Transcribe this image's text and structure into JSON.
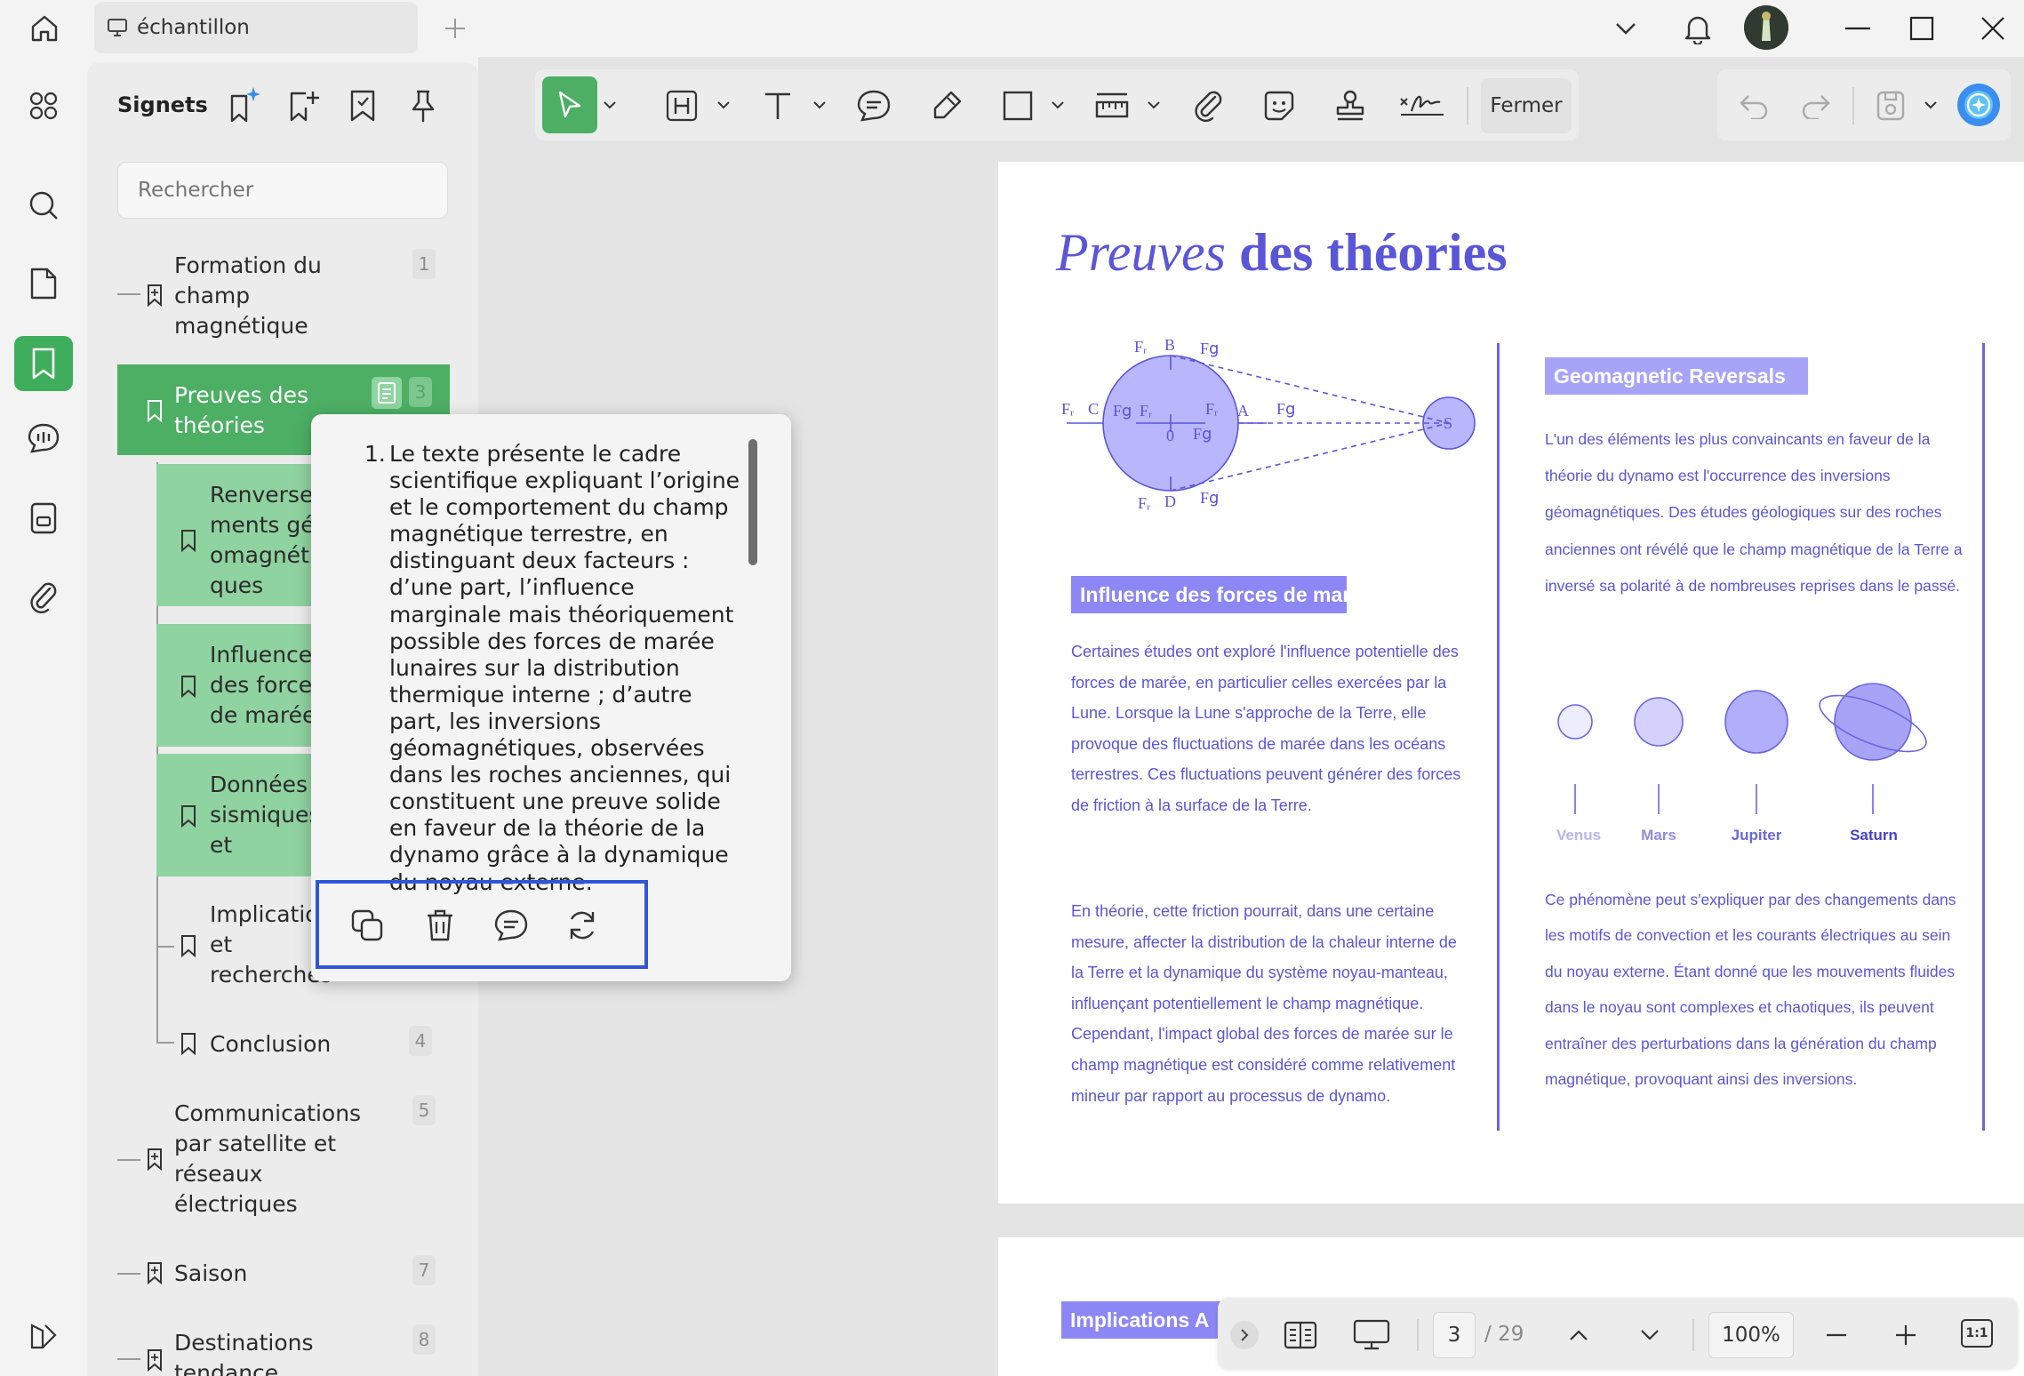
{
  "tab": {
    "title": "échantillon"
  },
  "sidebar": {
    "title": "Signets",
    "search_placeholder": "Rechercher"
  },
  "bookmarks": [
    {
      "label": "Formation du champ magnétique",
      "page": "1"
    },
    {
      "label": "Preuves des théories",
      "page": "3"
    },
    {
      "label": "Renversements géomagnétiques",
      "page": ""
    },
    {
      "label": "Influence des forces de marée",
      "page": ""
    },
    {
      "label": "Données sismiques et géodésiques",
      "page": ""
    },
    {
      "label": "Implications et recherches futures",
      "page": ""
    },
    {
      "label": "Conclusion",
      "page": "4"
    },
    {
      "label": "Communications par satellite et réseaux électriques",
      "page": "5"
    },
    {
      "label": "Saison",
      "page": "7"
    },
    {
      "label": "Destinations tendance",
      "page": "8"
    }
  ],
  "toolbar": {
    "close_label": "Fermer"
  },
  "popup": {
    "number": "1.",
    "text": "Le texte présente le cadre scientifique expliquant l’origine et le comportement du champ magnétique terrestre, en distinguant deux facteurs : d’une part, l’influence marginale mais théoriquement possible des forces de marée lunaires sur la distribution thermique interne ; d’autre part, les inversions géomagnétiques, observées dans les roches anciennes, qui constituent une preuve solide en faveur de la théorie de la dynamo grâce à la dynamique du noyau externe."
  },
  "page": {
    "title_italic": "Preuves",
    "title_bold": "des théories",
    "diagram_labels": {
      "fr": "Fᵣ",
      "fg": "F𝗀",
      "b": "B",
      "c": "C",
      "d": "D",
      "a": "A",
      "o": "0",
      "s": "S"
    },
    "left_heading": "Influence des forces de marée",
    "left_para1": "Certaines études ont exploré l'influence potentielle des forces de marée, en particulier celles exercées par la Lune. Lorsque la Lune s'approche de la Terre, elle provoque des fluctuations de marée dans les océans terrestres. Ces fluctuations peuvent générer des forces de friction à la surface de la Terre.",
    "left_para2": "En théorie, cette friction pourrait, dans une certaine mesure, affecter la distribution de la chaleur interne de la Terre et la dynamique du système noyau-manteau, influençant potentiellement le champ magnétique. Cependant, l'impact global des forces de marée sur le champ magnétique est considéré comme relativement mineur par rapport au processus de dynamo.",
    "right_heading": "Geomagnetic Reversals",
    "right_para1": "L'un des éléments les plus convaincants en faveur de la théorie du dynamo est l'occurrence des inversions géomagnétiques. Des études géologiques sur des roches anciennes ont révélé que le champ magnétique de la Terre a inversé sa polarité à de nombreuses reprises dans le passé.",
    "planets": [
      "Venus",
      "Mars",
      "Jupiter",
      "Saturn"
    ],
    "right_para2": "Ce phénomène peut s'expliquer par des changements dans les motifs de convection et les courants électriques au sein du noyau externe. Étant donné que les mouvements fluides dans le noyau sont complexes et chaotiques, ils peuvent entraîner des perturbations dans la génération du champ magnétique, provoquant ainsi des inversions.",
    "next_heading": "Implications A"
  },
  "bottombar": {
    "current_page": "3",
    "total_pages": "/ 29",
    "zoom": "100%",
    "fit": "1:1"
  },
  "colors": {
    "accent_green": "#4caf64",
    "doc_purple": "#5a56d8",
    "heading_bg": "#8c87f5",
    "highlight_border": "#2f56d6"
  }
}
